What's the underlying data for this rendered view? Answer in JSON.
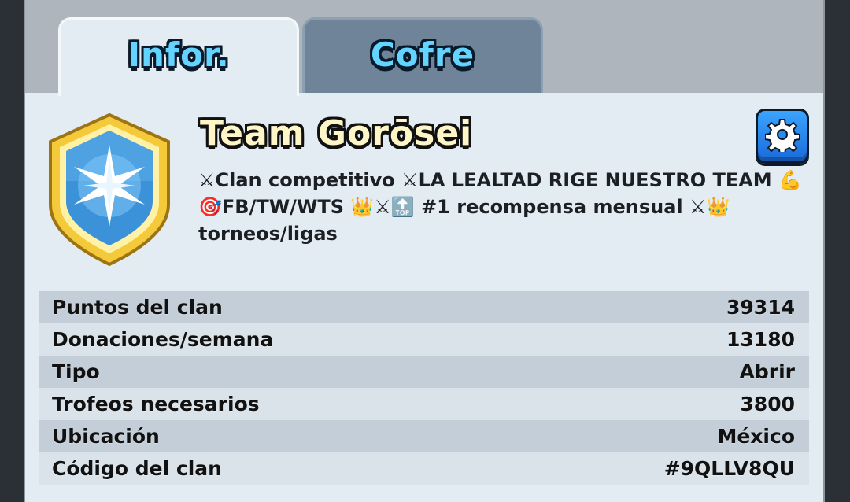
{
  "tabs": [
    {
      "label": "Infor.",
      "active": true
    },
    {
      "label": "Cofre",
      "active": false
    }
  ],
  "clan": {
    "name": "Team Gorōsei",
    "description": "⚔Clan competitivo ⚔LA LEALTAD RIGE NUESTRO TEAM 💪🎯FB/TW/WTS 👑⚔🔝 #1 recompensa mensual ⚔👑 torneos/ligas",
    "badge_icon": "star-shield-icon",
    "settings_icon": "gear-icon"
  },
  "stats": [
    {
      "label": "Puntos del clan",
      "value": "39314"
    },
    {
      "label": "Donaciones/semana",
      "value": "13180"
    },
    {
      "label": "Tipo",
      "value": "Abrir"
    },
    {
      "label": "Trofeos necesarios",
      "value": "3800"
    },
    {
      "label": "Ubicación",
      "value": "México"
    },
    {
      "label": "Código del clan",
      "value": "#9QLLV8QU"
    }
  ],
  "colors": {
    "tab_text": "#62d4ff",
    "clan_name": "#fff6c8",
    "panel": "#e3ecf3",
    "settings_button": "#2a8cf0"
  }
}
